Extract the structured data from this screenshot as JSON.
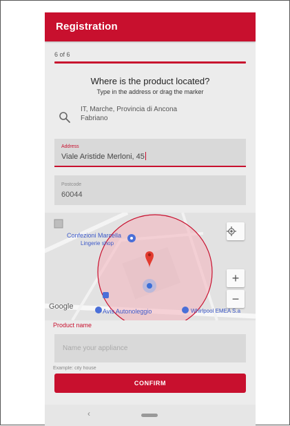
{
  "appbar": {
    "title": "Registration"
  },
  "step": {
    "text": "6 of 6"
  },
  "location": {
    "heading": "Where is the product located?",
    "subheading": "Type in the address or drag the marker",
    "search_icon": "search-icon",
    "search_line1": "IT, Marche, Provincia di Ancona",
    "search_line2": "Fabriano"
  },
  "address": {
    "label": "Address",
    "value": "Viale Aristide Merloni, 45"
  },
  "postcode": {
    "label": "Postcode",
    "value": "60044"
  },
  "map": {
    "poi_1": "Confezioni Marcella",
    "poi_1_sub": "Lingerie shop",
    "poi_2": "Avis Autonoleggio",
    "poi_3": "Whirlpool EMEA S.a",
    "google_logo": "Google",
    "locate_icon": "my-location-icon",
    "zoom_in": "+",
    "zoom_out": "−"
  },
  "product": {
    "label": "Product name",
    "placeholder": "Name your appliance",
    "example": "Example: city house"
  },
  "confirm": {
    "label": "CONFIRM"
  },
  "nav": {
    "back": "‹"
  },
  "colors": {
    "accent": "#c8102e",
    "field_bg": "#d9d9d9",
    "map_circle": "#f3b8c0"
  }
}
